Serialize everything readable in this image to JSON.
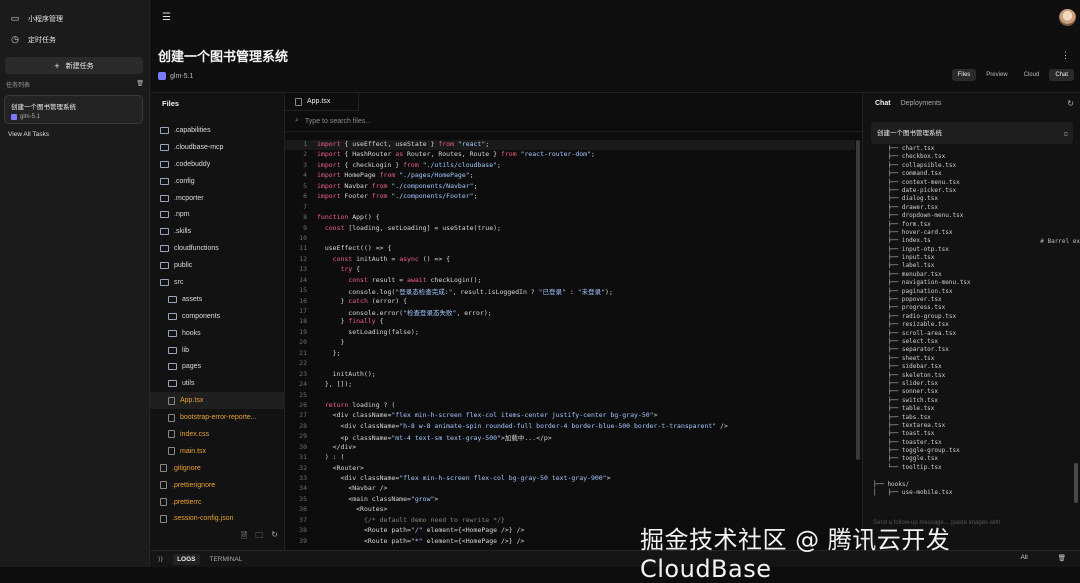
{
  "sidebar": {
    "items": [
      {
        "label": "小程序管理",
        "icon": "monitor-icon"
      },
      {
        "label": "定时任务",
        "icon": "clock-icon"
      }
    ],
    "new_task": "新建任务",
    "task_list_label": "任务列表",
    "task": {
      "title": "创建一个图书管理系统",
      "model": "glm-5.1"
    },
    "view_all": "View All Tasks"
  },
  "header": {
    "title": "创建一个图书管理系统",
    "model": "glm-5.1",
    "view_tabs": [
      "Files",
      "Preview",
      "Cloud",
      "Chat"
    ],
    "active_tab": "Files"
  },
  "files": {
    "heading": "Files",
    "tree": [
      {
        "name": ".capabilities",
        "type": "folder",
        "depth": 0
      },
      {
        "name": ".cloudbase-mcp",
        "type": "folder",
        "depth": 0
      },
      {
        "name": ".codebuddy",
        "type": "folder",
        "depth": 0
      },
      {
        "name": ".config",
        "type": "folder",
        "depth": 0
      },
      {
        "name": ".mcporter",
        "type": "folder",
        "depth": 0
      },
      {
        "name": ".npm",
        "type": "folder",
        "depth": 0
      },
      {
        "name": ".skills",
        "type": "folder",
        "depth": 0
      },
      {
        "name": "cloudfunctions",
        "type": "folder",
        "depth": 0
      },
      {
        "name": "public",
        "type": "folder",
        "depth": 0
      },
      {
        "name": "src",
        "type": "folder",
        "depth": 0
      },
      {
        "name": "assets",
        "type": "folder",
        "depth": 1
      },
      {
        "name": "components",
        "type": "folder",
        "depth": 1
      },
      {
        "name": "hooks",
        "type": "folder",
        "depth": 1
      },
      {
        "name": "lib",
        "type": "folder",
        "depth": 1
      },
      {
        "name": "pages",
        "type": "folder",
        "depth": 1
      },
      {
        "name": "utils",
        "type": "folder",
        "depth": 1
      },
      {
        "name": "App.tsx",
        "type": "file",
        "depth": 1,
        "color": "#e8a23a",
        "selected": true
      },
      {
        "name": "bootstrap-error-reporte...",
        "type": "file",
        "depth": 1,
        "color": "#e8a23a"
      },
      {
        "name": "index.css",
        "type": "file",
        "depth": 1,
        "color": "#e8a23a"
      },
      {
        "name": "main.tsx",
        "type": "file",
        "depth": 1,
        "color": "#e8a23a"
      },
      {
        "name": ".gitignore",
        "type": "file",
        "depth": 0,
        "color": "#e8a23a"
      },
      {
        "name": ".prettierignore",
        "type": "file",
        "depth": 0,
        "color": "#e8a23a"
      },
      {
        "name": ".prettierrc",
        "type": "file",
        "depth": 0,
        "color": "#e8a23a"
      },
      {
        "name": ".session-config.json",
        "type": "file",
        "depth": 0,
        "color": "#e8a23a"
      }
    ]
  },
  "editor": {
    "tab": "App.tsx",
    "search_placeholder": "Type to search files...",
    "lines": [
      "import { useEffect, useState } from \"react\";",
      "import { HashRouter as Router, Routes, Route } from \"react-router-dom\";",
      "import { checkLogin } from \"./utils/cloudbase\";",
      "import HomePage from \"./pages/HomePage\";",
      "import Navbar from \"./components/Navbar\";",
      "import Footer from \"./components/Footer\";",
      "",
      "function App() {",
      "  const [loading, setLoading] = useState(true);",
      "",
      "  useEffect(() => {",
      "    const initAuth = async () => {",
      "      try {",
      "        const result = await checkLogin();",
      "        console.log(\"登录态检查完成:\", result.isLoggedIn ? \"已登录\" : \"未登录\");",
      "      } catch (error) {",
      "        console.error(\"检查登录态失败\", error);",
      "      } finally {",
      "        setLoading(false);",
      "      }",
      "    };",
      "",
      "    initAuth();",
      "  }, []);",
      "",
      "  return loading ? (",
      "    <div className=\"flex min-h-screen flex-col items-center justify-center bg-gray-50\">",
      "      <div className=\"h-8 w-8 animate-spin rounded-full border-4 border-blue-500 border-t-transparent\" />",
      "      <p className=\"mt-4 text-sm text-gray-500\">加载中...</p>",
      "    </div>",
      "  ) : (",
      "    <Router>",
      "      <div className=\"flex min-h-screen flex-col bg-gray-50 text-gray-900\">",
      "        <Navbar />",
      "        <main className=\"grow\">",
      "          <Routes>",
      "            {/* default demo need to rewrite */}",
      "            <Route path=\"/\" element={<HomePage />} />",
      "            <Route path=\"*\" element={<HomePage />} />"
    ]
  },
  "chat": {
    "tabs": [
      "Chat",
      "Deployments"
    ],
    "message": "创建一个图书管理系统",
    "tree_lines": [
      "    ├── chart.tsx",
      "    ├── checkbox.tsx",
      "    ├── collapsible.tsx",
      "    ├── command.tsx",
      "    ├── context-menu.tsx",
      "    ├── date-picker.tsx",
      "    ├── dialog.tsx",
      "    ├── drawer.tsx",
      "    ├── dropdown-menu.tsx",
      "    ├── form.tsx",
      "    ├── hover-card.tsx",
      "    ├── index.ts",
      "    ├── input-otp.tsx",
      "    ├── input.tsx",
      "    ├── label.tsx",
      "    ├── menubar.tsx",
      "    ├── navigation-menu.tsx",
      "    ├── pagination.tsx",
      "    ├── popover.tsx",
      "    ├── progress.tsx",
      "    ├── radio-group.tsx",
      "    ├── resizable.tsx",
      "    ├── scroll-area.tsx",
      "    ├── select.tsx",
      "    ├── separator.tsx",
      "    ├── sheet.tsx",
      "    ├── sidebar.tsx",
      "    ├── skeleton.tsx",
      "    ├── slider.tsx",
      "    ├── sonner.tsx",
      "    ├── switch.tsx",
      "    ├── table.tsx",
      "    ├── tabs.tsx",
      "    ├── textarea.tsx",
      "    ├── toast.tsx",
      "    ├── toaster.tsx",
      "    ├── toggle-group.tsx",
      "    ├── toggle.tsx",
      "    └── tooltip.tsx",
      "",
      "├── hooks/",
      "│   ├── use-mobile.tsx"
    ],
    "barrel_comment": "# Barrel ex",
    "input_placeholder": "Send a follow-up message... (paste images with"
  },
  "bottom": {
    "tabs": [
      "LOGS",
      "TERMINAL"
    ],
    "filter": "All"
  },
  "watermark": "掘金技术社区 @ 腾讯云开发CloudBase"
}
